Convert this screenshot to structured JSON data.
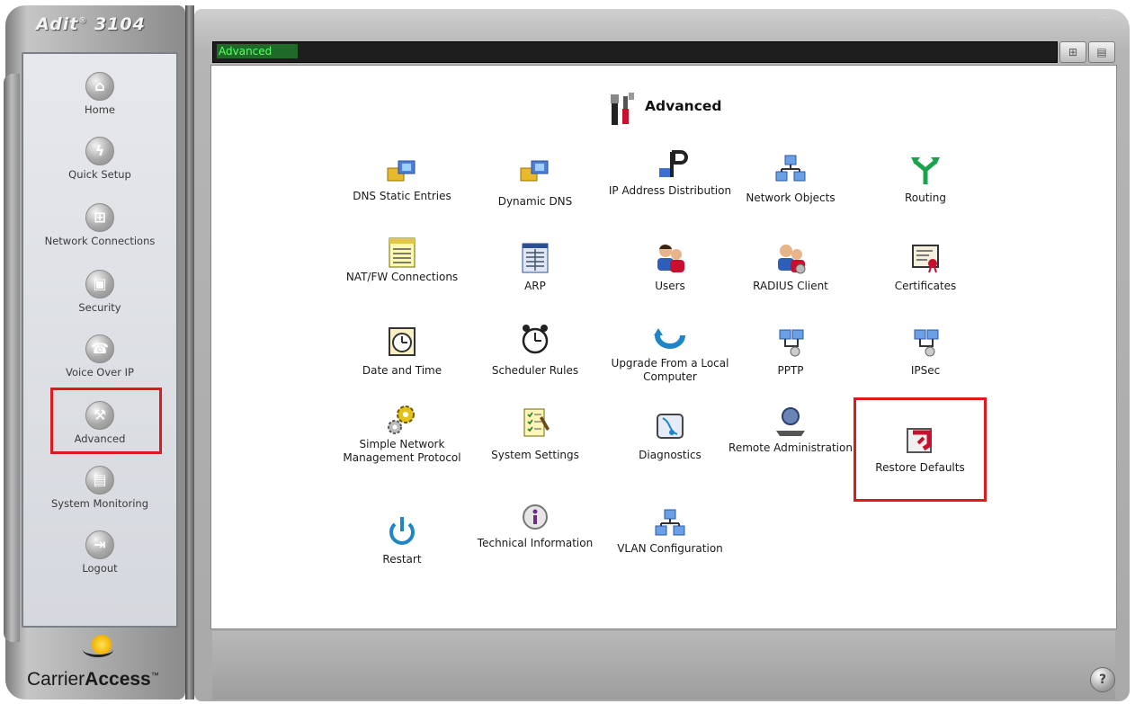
{
  "brand": {
    "name": "Adit",
    "mark": "®",
    "model": "3104"
  },
  "sidebar": {
    "items": [
      {
        "label": "Home",
        "icon": "home-icon",
        "glyph": "⌂"
      },
      {
        "label": "Quick Setup",
        "icon": "lightning-icon",
        "glyph": "ϟ"
      },
      {
        "label": "Network Connections",
        "icon": "network-icon",
        "glyph": "⊞"
      },
      {
        "label": "Security",
        "icon": "lock-icon",
        "glyph": "▣"
      },
      {
        "label": "Voice Over IP",
        "icon": "phone-icon",
        "glyph": "☎"
      },
      {
        "label": "Advanced",
        "icon": "tools-icon",
        "glyph": "⚒"
      },
      {
        "label": "System Monitoring",
        "icon": "monitor-icon",
        "glyph": "▤"
      },
      {
        "label": "Logout",
        "icon": "logout-icon",
        "glyph": "⇥"
      }
    ],
    "selected": "Advanced"
  },
  "title_bar": {
    "text": "Advanced"
  },
  "page": {
    "title": "Advanced",
    "tiles": [
      {
        "label": "DNS Static Entries",
        "icon": "dns-computers-icon"
      },
      {
        "label": "Dynamic DNS",
        "icon": "dynamic-dns-icon"
      },
      {
        "label": "IP Address Distribution",
        "icon": "ip-plug-icon"
      },
      {
        "label": "Network Objects",
        "icon": "network-objects-icon"
      },
      {
        "label": "Routing",
        "icon": "routing-arrow-icon"
      },
      {
        "label": "NAT/FW Connections",
        "icon": "nat-table-icon"
      },
      {
        "label": "ARP",
        "icon": "arp-table-icon"
      },
      {
        "label": "Users",
        "icon": "users-icon"
      },
      {
        "label": "RADIUS Client",
        "icon": "radius-users-icon"
      },
      {
        "label": "Certificates",
        "icon": "certificate-icon"
      },
      {
        "label": "Date and Time",
        "icon": "clock-icon"
      },
      {
        "label": "Scheduler Rules",
        "icon": "alarm-clock-icon"
      },
      {
        "label": "Upgrade From a Local Computer",
        "icon": "upgrade-arrow-icon"
      },
      {
        "label": "PPTP",
        "icon": "pptp-icon"
      },
      {
        "label": "IPSec",
        "icon": "ipsec-icon"
      },
      {
        "label": "Simple Network Management Protocol",
        "icon": "gears-icon"
      },
      {
        "label": "System Settings",
        "icon": "checklist-icon"
      },
      {
        "label": "Diagnostics",
        "icon": "diagnostics-icon"
      },
      {
        "label": "Remote Administration",
        "icon": "remote-admin-icon"
      },
      {
        "label": "Restore Defaults",
        "icon": "restore-icon"
      },
      {
        "label": "Restart",
        "icon": "power-icon"
      },
      {
        "label": "Technical Information",
        "icon": "info-icon"
      },
      {
        "label": "VLAN Configuration",
        "icon": "vlan-icon"
      }
    ],
    "highlighted_tile": "Restore Defaults"
  },
  "footer": {
    "logo_text_light": "Carrier",
    "logo_text_bold": "Access",
    "logo_mark": "™"
  },
  "help": {
    "label": "?"
  },
  "colors": {
    "highlight": "#e0191c",
    "title_green": "#5dff5d",
    "title_bg": "#1f6a28"
  }
}
